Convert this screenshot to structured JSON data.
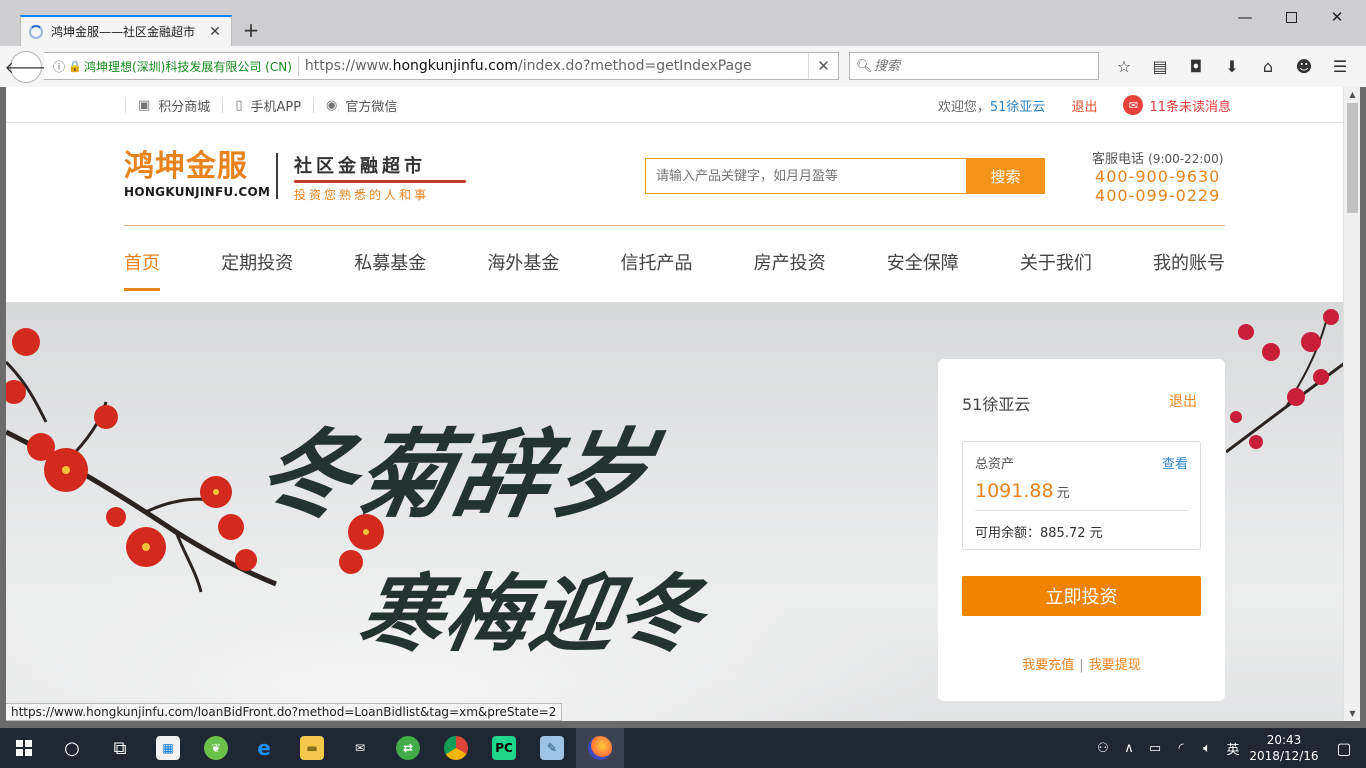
{
  "browser": {
    "tab_title": "鸿坤金服——社区金融超市",
    "new_tab": "+",
    "identity": "鸿坤理想(深圳)科技发展有限公司 (CN)",
    "url_prefix": "https://www.",
    "url_domain": "hongkunjinfu.com",
    "url_path": "/index.do?method=getIndexPage",
    "search_placeholder": "搜索",
    "status_url": "https://www.hongkunjinfu.com/loanBidFront.do?method=LoanBidlist&tag=xm&preState=2"
  },
  "topbar": {
    "links": [
      {
        "label": "积分商城",
        "icon": "store-icon"
      },
      {
        "label": "手机APP",
        "icon": "phone-icon"
      },
      {
        "label": "官方微信",
        "icon": "wechat-icon"
      }
    ],
    "welcome": "欢迎您，",
    "username": "51徐亚云",
    "logout": "退出",
    "messages": "11条未读消息"
  },
  "header": {
    "logo_cn": "鸿坤金服",
    "logo_en": "HONGKUNJINFU.COM",
    "slogan_main": "社区金融超市",
    "slogan_sub": "投资您熟悉的人和事",
    "search_placeholder": "请输入产品关键字，如月月盈等",
    "search_button": "搜索",
    "hotline_label": "客服电话",
    "hotline_hours": "(9:00-22:00)",
    "phone1": "400-900-9630",
    "phone2": "400-099-0229"
  },
  "nav": {
    "items": [
      "首页",
      "定期投资",
      "私募基金",
      "海外基金",
      "信托产品",
      "房产投资",
      "安全保障",
      "关于我们",
      "我的账号"
    ],
    "active_index": 0
  },
  "banner": {
    "line1": "冬菊辞岁",
    "line2": "寒梅迎冬"
  },
  "account_card": {
    "username": "51徐亚云",
    "logout": "退出",
    "total_label": "总资产",
    "view_link": "查看",
    "total_amount": "1091.88",
    "unit": "元",
    "balance_text": "可用余额：885.72 元",
    "invest_button": "立即投资",
    "recharge": "我要充值",
    "separator": "|",
    "withdraw": "我要提现"
  },
  "taskbar": {
    "time": "20:43",
    "date": "2018/12/16",
    "ime": "英"
  },
  "colors": {
    "brand_orange": "#e9831e",
    "button_orange": "#f08400",
    "link_blue": "#2f86c8",
    "alert_red": "#e8433c"
  }
}
